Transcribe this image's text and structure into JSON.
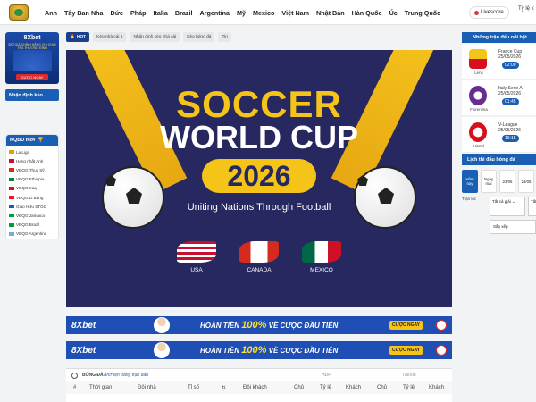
{
  "nav": {
    "items": [
      "Anh",
      "Tây Ban Nha",
      "Đức",
      "Pháp",
      "Italia",
      "Brazil",
      "Argentina",
      "Mỹ",
      "Mexico",
      "Việt Nam",
      "Nhật Bản",
      "Hàn Quốc",
      "Úc",
      "Trung Quốc"
    ],
    "livescore": "Livescore",
    "odds_rate": "Tỷ lệ k"
  },
  "left_sidebar": {
    "ad": {
      "brand": "8Xbet",
      "sub": "ĐỒI GIÀ CHÍNH HÃNG CHI CHỐI TRẢ THƯỞNG ĐỈNH",
      "cta": "CƯỢC NGAY"
    },
    "tips_button": "Nhận định kèo",
    "kqbd_title": "KQBD mới",
    "kqbd_items": [
      {
        "label": "La Liga",
        "color": "#e0a000"
      },
      {
        "label": "Hạng nhất Anh",
        "color": "#c8102e"
      },
      {
        "label": "VĐQG Thụy Sỹ",
        "color": "#d52b1e"
      },
      {
        "label": "VĐQG Ethiopia",
        "color": "#078930"
      },
      {
        "label": "VĐQG Iraq",
        "color": "#ce1126"
      },
      {
        "label": "VĐQG Li Băng",
        "color": "#ee161f"
      },
      {
        "label": "Giao Hữu STGG",
        "color": "#1a5fb4"
      },
      {
        "label": "VĐQG Jamaica",
        "color": "#009b3a"
      },
      {
        "label": "VĐQG Brazil",
        "color": "#009c3b"
      },
      {
        "label": "VĐQG Argentina",
        "color": "#74acdf"
      }
    ]
  },
  "filters": [
    "HOT",
    "Kèo nhà cái 5",
    "Nhận định kèo nhà cái",
    "Kèo bóng đá",
    "Tin"
  ],
  "banner": {
    "line1": "SOCCER",
    "line2": "WORLD CUP",
    "year": "2026",
    "tagline": "Uniting Nations Through Football",
    "countries": [
      "USA",
      "CANADA",
      "MEXICO"
    ]
  },
  "promo": {
    "brand": "8Xbet",
    "text_a": "HOÀN TIỀN",
    "pct": "100%",
    "text_b": "VỀ CƯỢC ĐẦU TIÊN",
    "button": "CƯỢC NGAY"
  },
  "results": {
    "section": "BÓNG ĐÁ",
    "hint": "Ẩn/Hiện bảng trận đấu",
    "hdp": "HDP",
    "taixiu": "Tài/Xỉu",
    "columns": [
      "#",
      "Thời gian",
      "Đội nhà",
      "Tỉ số",
      "Đội khách",
      "Chủ",
      "Tỷ lệ",
      "Khách",
      "Chủ",
      "Tỷ lệ",
      "Khách"
    ]
  },
  "right_sidebar": {
    "title": "Những trận đấu nổi bật",
    "matches": [
      {
        "team": "Lens",
        "league": "France Cup",
        "date": "25/05/2026",
        "time": "02:00",
        "color": "#f5c418"
      },
      {
        "team": "Fiorentina",
        "league": "Italy Serie A",
        "date": "25/05/2026",
        "time": "01:45",
        "color": "#6a2c91"
      },
      {
        "team": "Viettel",
        "league": "V-League",
        "date": "25/05/2026",
        "time": "19:15",
        "color": "#d6101e"
      }
    ],
    "schedule_title": "Lịch thi đấu bóng đá",
    "tabs": [
      "Hôm nay",
      "Ngày mai",
      "23/05",
      "24/05"
    ],
    "filter_label": "Trận lọc",
    "select1": "Tất cả giải",
    "select2": "Tất",
    "select3": "Sắp xếp"
  }
}
